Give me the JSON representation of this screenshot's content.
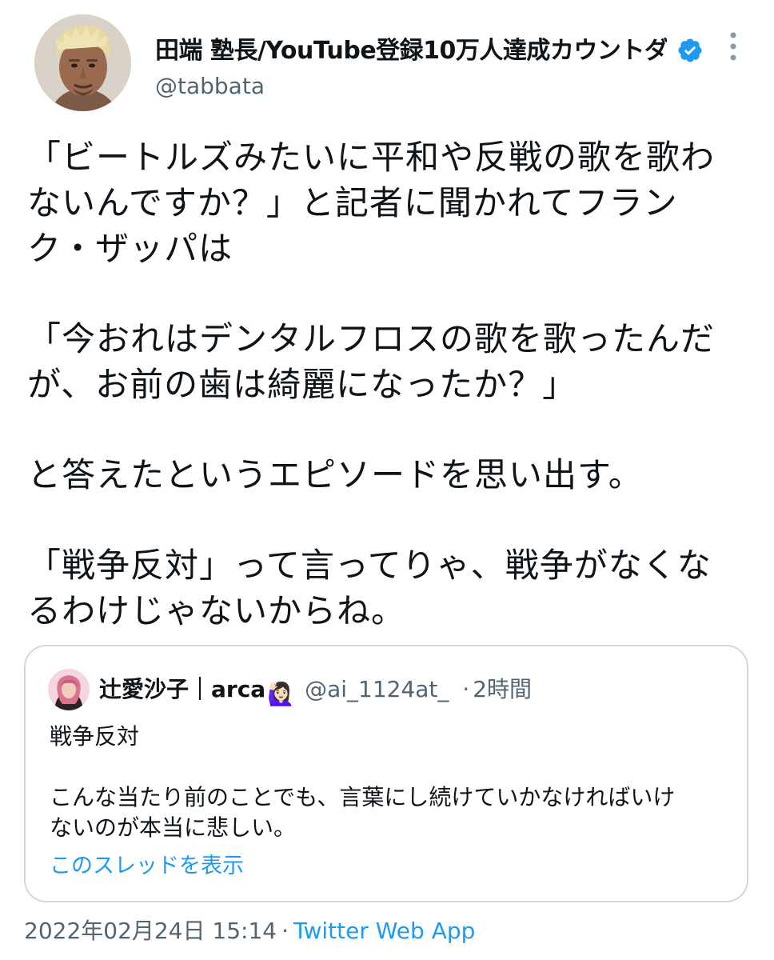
{
  "author": {
    "display_name": "田端 塾長/YouTube登録10万人達成カウントダ…",
    "handle": "@tabbata",
    "avatar_icon": "user-avatar-photo",
    "verified_icon": "verified-badge-icon",
    "more_icon": "more-vertical-icon"
  },
  "tweet": {
    "paragraphs": [
      "「ビートルズみたいに平和や反戦の歌を歌わ\nないんですか？」と記者に聞かれてフラン\nク・ザッパは",
      "「今おれはデンタルフロスの歌を歌ったんだ\nが、お前の歯は綺麗になったか？」",
      "と答えたというエピソードを思い出す。",
      "「戦争反対」って言ってりゃ、戦争がなくな\nるわけじゃないからね。"
    ]
  },
  "quote": {
    "name": "辻愛沙子｜arca",
    "emoji": "🙋🏻‍♀️",
    "handle": "@ai_1124at_",
    "separator": "·",
    "time": "2時間",
    "paragraphs": [
      "戦争反対",
      "こんな当たり前のことでも、言葉にし続けていかなければいけ\nないのが本当に悲しい。"
    ],
    "show_thread": "このスレッドを表示"
  },
  "footer": {
    "timestamp": "2022年02月24日 15:14",
    "separator": "·",
    "source": "Twitter Web App"
  },
  "colors": {
    "text": "#0f1419",
    "secondary": "#536471",
    "link": "#1d9bf0",
    "border": "#cfd9de"
  }
}
